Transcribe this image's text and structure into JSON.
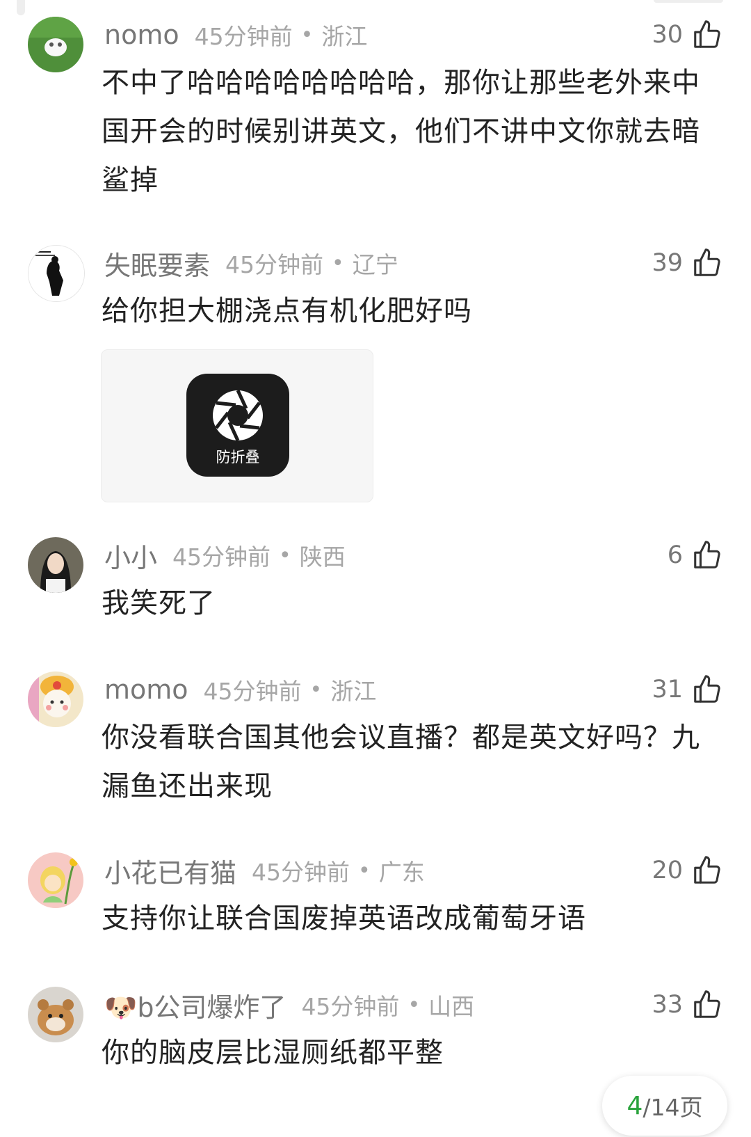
{
  "colors": {
    "text_primary": "#222222",
    "text_secondary": "#777777",
    "text_meta": "#a6a6a6",
    "pager_accent": "#2aa33c"
  },
  "comments": [
    {
      "username": "nomo",
      "time": "45分钟前",
      "location": "浙江",
      "likes": "30",
      "text": "不中了哈哈哈哈哈哈哈哈，那你让那些老外来中国开会的时候别讲英文，他们不讲中文你就去暗鲨掉",
      "avatar_icon": "white-dog-on-grass-avatar"
    },
    {
      "username": "失眠要素",
      "time": "45分钟前",
      "location": "辽宁",
      "likes": "39",
      "text": "给你担大棚浇点有机化肥好吗",
      "avatar_icon": "figure-in-black-avatar",
      "image": {
        "icon": "camera-aperture-icon",
        "label": "防折叠"
      }
    },
    {
      "username": "小小",
      "time": "45分钟前",
      "location": "陕西",
      "likes": "6",
      "text": "我笑死了",
      "avatar_icon": "girl-portrait-avatar"
    },
    {
      "username": "momo",
      "time": "45分钟前",
      "location": "浙江",
      "likes": "31",
      "text": "你没看联合国其他会议直播？都是英文好吗？九漏鱼还出来现",
      "avatar_icon": "cartoon-bear-avatar"
    },
    {
      "username": "小花已有猫",
      "time": "45分钟前",
      "location": "广东",
      "likes": "20",
      "text": "支持你让联合国废掉英语改成葡萄牙语",
      "avatar_icon": "cartoon-prince-avatar"
    },
    {
      "username": "🐶b公司爆炸了",
      "time": "45分钟前",
      "location": "山西",
      "likes": "33",
      "text": "你的脑皮层比湿厕纸都平整",
      "avatar_icon": "hamster-avatar"
    }
  ],
  "pager": {
    "current": "4",
    "rest": "/14页"
  }
}
